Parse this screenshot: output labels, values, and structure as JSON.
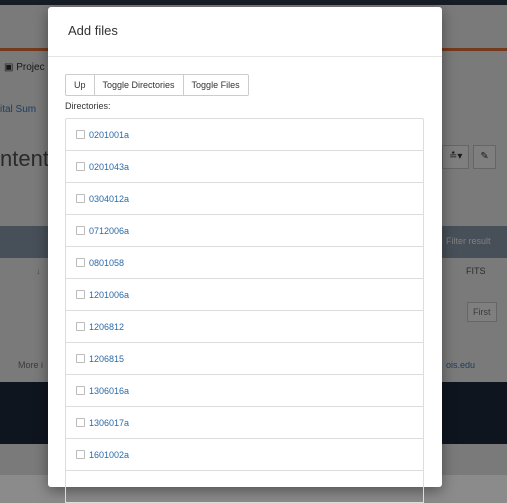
{
  "background": {
    "tab_label": "Projec",
    "link_text": "ital Sum",
    "heading": "ntent",
    "tools": [
      "≛▾",
      "✎"
    ],
    "filter_text": "Filter result",
    "column_label": "↓",
    "fits_label": "FITS",
    "first_button": "First",
    "more_text": "More i",
    "edu_text": "ois.edu"
  },
  "modal": {
    "title": "Add files",
    "buttons": {
      "up": "Up",
      "toggle_directories": "Toggle Directories",
      "toggle_files": "Toggle Files"
    },
    "directories_label": "Directories:",
    "directories": [
      "0201001a",
      "0201043a",
      "0304012a",
      "0712006a",
      "0801058",
      "1201006a",
      "1206812",
      "1206815",
      "1306016a",
      "1306017a",
      "1601002a",
      ""
    ]
  },
  "colors": {
    "link": "#2d6aa6",
    "accent_orange": "#e8743b",
    "footer": "#1f2b3e"
  }
}
